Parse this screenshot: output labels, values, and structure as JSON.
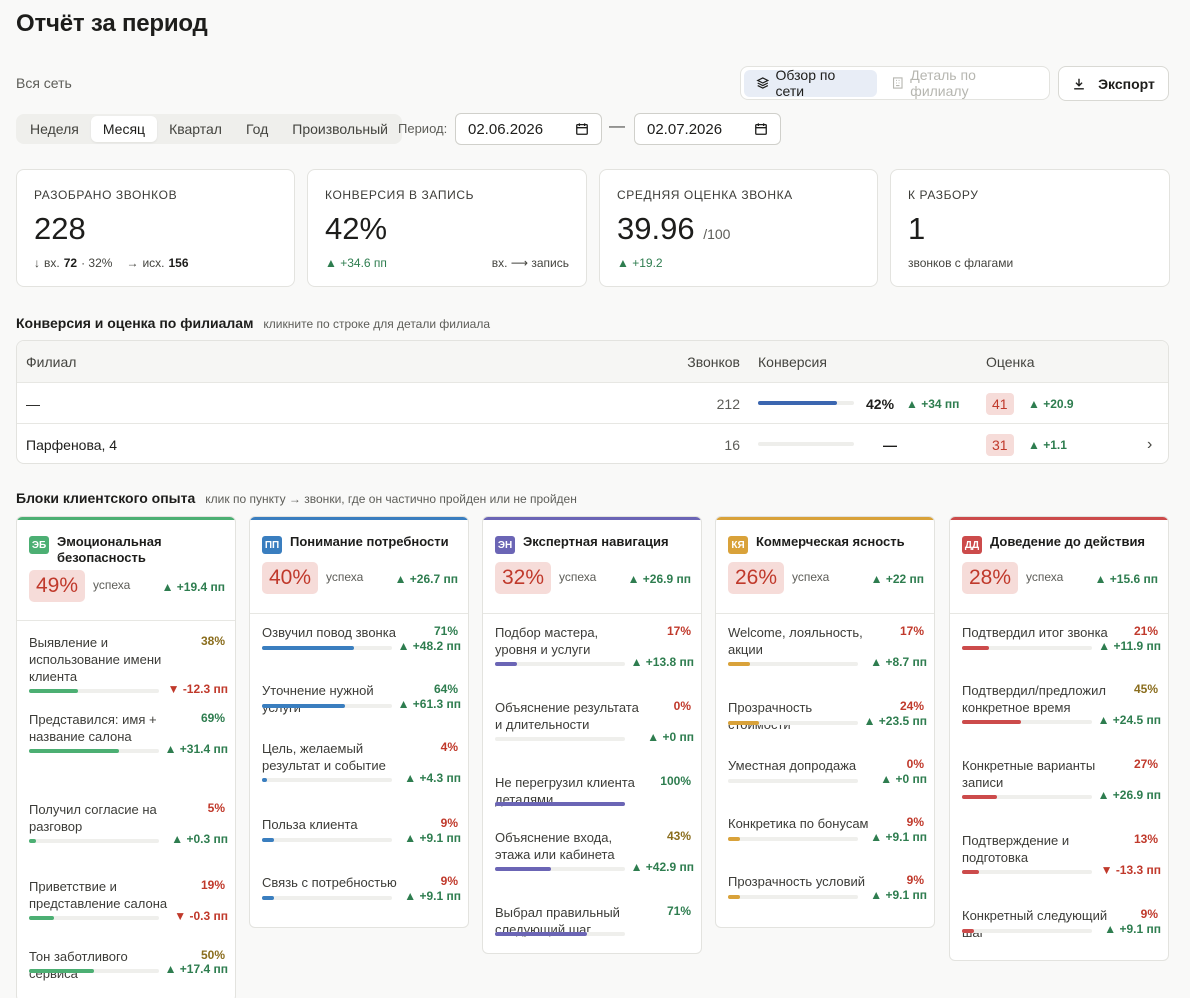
{
  "page": {
    "title": "Отчёт за период",
    "scope": "Вся сеть"
  },
  "view_toggle": {
    "network": "Обзор по сети",
    "branch": "Деталь по филиалу"
  },
  "export": {
    "label": "Экспорт"
  },
  "period": {
    "tabs": [
      "Неделя",
      "Месяц",
      "Квартал",
      "Год",
      "Произвольный"
    ],
    "active": "Месяц",
    "label": "Период:",
    "from": "02.06.2026",
    "dash": "—",
    "to": "02.07.2026"
  },
  "kpis": {
    "calls": {
      "label": "Разобрано звонков",
      "value": "228",
      "in_label": "вх.",
      "in_value": "72",
      "in_share": "· 32%",
      "out_label": "исх.",
      "out_value": "156"
    },
    "conversion": {
      "label": "Конверсия в запись",
      "value": "42%",
      "delta": "+34.6 пп",
      "note": "вх. ⟶ запись"
    },
    "score": {
      "label": "Средняя оценка звонка",
      "value": "39.96",
      "unit": "/100",
      "delta": "+19.2"
    },
    "review": {
      "label": "К разбору",
      "value": "1",
      "note": "звонков с флагами"
    }
  },
  "branches": {
    "title": "Конверсия и оценка по филиалам",
    "hint": "кликните по строке для детали филиала",
    "columns": {
      "branch": "Филиал",
      "calls": "Звонков",
      "conversion": "Конверсия",
      "score": "Оценка"
    },
    "rows": [
      {
        "name": "—",
        "calls": "212",
        "conv_text": "42%",
        "conv_fraction": 0.82,
        "conv_delta": "+34 пп",
        "score": "41",
        "score_delta": "+20.9"
      },
      {
        "name": "Парфенова, 4",
        "calls": "16",
        "conv_text": "—",
        "conv_fraction": 0,
        "conv_delta": "",
        "score": "31",
        "score_delta": "+1.1"
      }
    ]
  },
  "blocks": {
    "title": "Блоки клиентского опыта",
    "hint": "клик по пункту → звонки, где он частично пройден или не пройден",
    "success_label": "успеха",
    "cards": [
      {
        "badge": "ЭБ",
        "color": "#4caf73",
        "title": "Эмоциональная безопасность",
        "pct": "49%",
        "delta": "+19.4 пп",
        "items": [
          {
            "label": "Выявление и использование имени клиента",
            "pct": "38%",
            "value": 38,
            "delta": "-12.3 пп",
            "dir": "down"
          },
          {
            "label": "Представился: имя + название салона",
            "pct": "69%",
            "value": 69,
            "delta": "+31.4 пп",
            "dir": "up"
          },
          {
            "label": "Получил согласие на разговор",
            "pct": "5%",
            "value": 5,
            "delta": "+0.3 пп",
            "dir": "up"
          },
          {
            "label": "Приветствие и представление салона",
            "pct": "19%",
            "value": 19,
            "delta": "-0.3 пп",
            "dir": "down"
          },
          {
            "label": "Тон заботливого сервиса",
            "pct": "50%",
            "value": 50,
            "delta": "+17.4 пп",
            "dir": "up"
          }
        ]
      },
      {
        "badge": "ПП",
        "color": "#3a7ebf",
        "title": "Понимание потребности",
        "pct": "40%",
        "delta": "+26.7 пп",
        "items": [
          {
            "label": "Озвучил повод звонка",
            "pct": "71%",
            "value": 71,
            "delta": "+48.2 пп",
            "dir": "up"
          },
          {
            "label": "Уточнение нужной услуги",
            "pct": "64%",
            "value": 64,
            "delta": "+61.3 пп",
            "dir": "up"
          },
          {
            "label": "Цель, желаемый результат и событие",
            "pct": "4%",
            "value": 4,
            "delta": "+4.3 пп",
            "dir": "up"
          },
          {
            "label": "Польза клиента",
            "pct": "9%",
            "value": 9,
            "delta": "+9.1 пп",
            "dir": "up"
          },
          {
            "label": "Связь с потребностью",
            "pct": "9%",
            "value": 9,
            "delta": "+9.1 пп",
            "dir": "up"
          }
        ]
      },
      {
        "badge": "ЭН",
        "color": "#6b65b5",
        "title": "Экспертная навигация",
        "pct": "32%",
        "delta": "+26.9 пп",
        "items": [
          {
            "label": "Подбор мастера, уровня и услуги",
            "pct": "17%",
            "value": 17,
            "delta": "+13.8 пп",
            "dir": "up"
          },
          {
            "label": "Объяснение результата и длительности",
            "pct": "0%",
            "value": 0,
            "delta": "+0 пп",
            "dir": "up"
          },
          {
            "label": "Не перегрузил клиента деталями",
            "pct": "100%",
            "value": 100,
            "delta": "",
            "dir": "up"
          },
          {
            "label": "Объяснение входа, этажа или кабинета",
            "pct": "43%",
            "value": 43,
            "delta": "+42.9 пп",
            "dir": "up"
          },
          {
            "label": "Выбрал правильный следующий шаг",
            "pct": "71%",
            "value": 71,
            "delta": "",
            "dir": "up"
          }
        ]
      },
      {
        "badge": "КЯ",
        "color": "#d9a23a",
        "title": "Коммерческая ясность",
        "pct": "26%",
        "delta": "+22 пп",
        "items": [
          {
            "label": "Welcome, лояльность, акции",
            "pct": "17%",
            "value": 17,
            "delta": "+8.7 пп",
            "dir": "up"
          },
          {
            "label": "Прозрачность стоимости",
            "pct": "24%",
            "value": 24,
            "delta": "+23.5 пп",
            "dir": "up"
          },
          {
            "label": "Уместная допродажа",
            "pct": "0%",
            "value": 0,
            "delta": "+0 пп",
            "dir": "up"
          },
          {
            "label": "Конкретика по бонусам",
            "pct": "9%",
            "value": 9,
            "delta": "+9.1 пп",
            "dir": "up"
          },
          {
            "label": "Прозрачность условий",
            "pct": "9%",
            "value": 9,
            "delta": "+9.1 пп",
            "dir": "up"
          }
        ]
      },
      {
        "badge": "ДД",
        "color": "#cc4b4b",
        "title": "Доведение до действия",
        "pct": "28%",
        "delta": "+15.6 пп",
        "items": [
          {
            "label": "Подтвердил итог звонка",
            "pct": "21%",
            "value": 21,
            "delta": "+11.9 пп",
            "dir": "up"
          },
          {
            "label": "Подтвердил/предложил конкретное время",
            "pct": "45%",
            "value": 45,
            "delta": "+24.5 пп",
            "dir": "up"
          },
          {
            "label": "Конкретные варианты записи",
            "pct": "27%",
            "value": 27,
            "delta": "+26.9 пп",
            "dir": "up"
          },
          {
            "label": "Подтверждение и подготовка",
            "pct": "13%",
            "value": 13,
            "delta": "-13.3 пп",
            "dir": "down"
          },
          {
            "label": "Конкретный следующий шаг",
            "pct": "9%",
            "value": 9,
            "delta": "+9.1 пп",
            "dir": "up"
          }
        ]
      }
    ]
  }
}
